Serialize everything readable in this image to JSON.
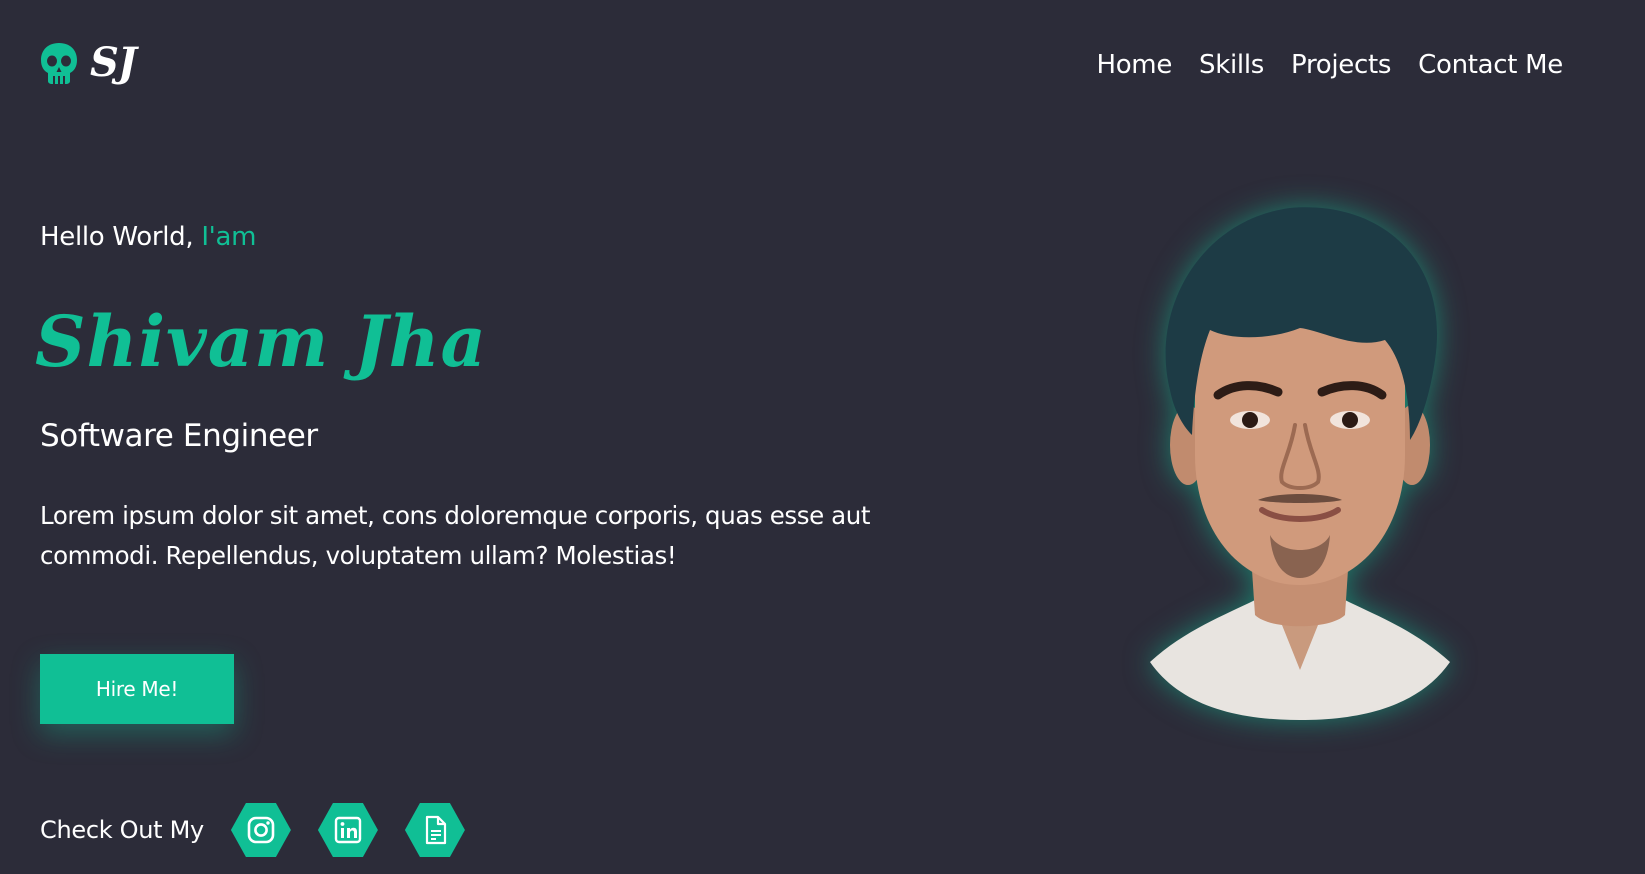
{
  "header": {
    "logo_text": "SJ",
    "logo_icon": "skull-icon",
    "nav": [
      {
        "label": "Home"
      },
      {
        "label": "Skills"
      },
      {
        "label": "Projects"
      },
      {
        "label": "Contact Me"
      }
    ]
  },
  "hero": {
    "greeting": "Hello World, ",
    "greeting_accent": "I'am",
    "name": "Shivam Jha",
    "role": "Software Engineer",
    "intro": "Lorem ipsum dolor sit amet, cons doloremque corporis, quas esse aut commodi. Repellendus, voluptatem ullam? Molestias!",
    "cta_label": "Hire Me!"
  },
  "socials": {
    "label": "Check Out My",
    "links": [
      {
        "icon": "instagram-icon"
      },
      {
        "icon": "linkedin-icon"
      },
      {
        "icon": "document-icon"
      }
    ]
  },
  "colors": {
    "background": "#2c2c39",
    "accent": "#10bf95",
    "text": "#ffffff"
  }
}
